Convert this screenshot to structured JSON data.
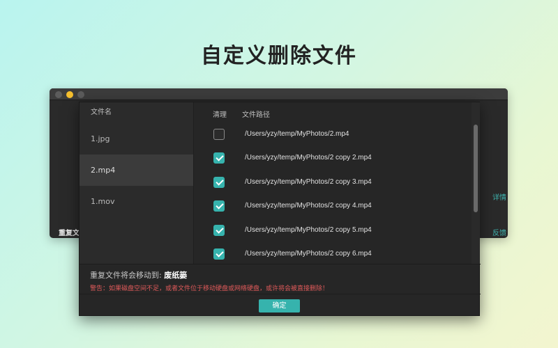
{
  "headline": "自定义删除文件",
  "background_window": {
    "bottom_left_label": "重复文",
    "right_link_1": "详情",
    "right_link_2": "反馈"
  },
  "dialog": {
    "left_header": "文件名",
    "files": [
      {
        "name": "1.jpg",
        "selected": false
      },
      {
        "name": "2.mp4",
        "selected": true
      },
      {
        "name": "1.mov",
        "selected": false
      }
    ],
    "col_clean": "清理",
    "col_path": "文件路径",
    "paths": [
      {
        "path": "/Users/yzy/temp/MyPhotos/2.mp4",
        "checked": false
      },
      {
        "path": "/Users/yzy/temp/MyPhotos/2 copy 2.mp4",
        "checked": true
      },
      {
        "path": "/Users/yzy/temp/MyPhotos/2 copy 3.mp4",
        "checked": true
      },
      {
        "path": "/Users/yzy/temp/MyPhotos/2 copy 4.mp4",
        "checked": true
      },
      {
        "path": "/Users/yzy/temp/MyPhotos/2 copy 5.mp4",
        "checked": true
      },
      {
        "path": "/Users/yzy/temp/MyPhotos/2 copy 6.mp4",
        "checked": true
      }
    ],
    "move_label": "重复文件将会移动到:",
    "move_target": "废纸篓",
    "warning": "警告：如果磁盘空间不足，或者文件位于移动硬盘或网络硬盘，或许将会被直接删除！",
    "ok_label": "确定"
  },
  "colors": {
    "accent": "#36b3ad",
    "warning": "#e05a5a",
    "yellow_light": "#f5bf2e"
  }
}
